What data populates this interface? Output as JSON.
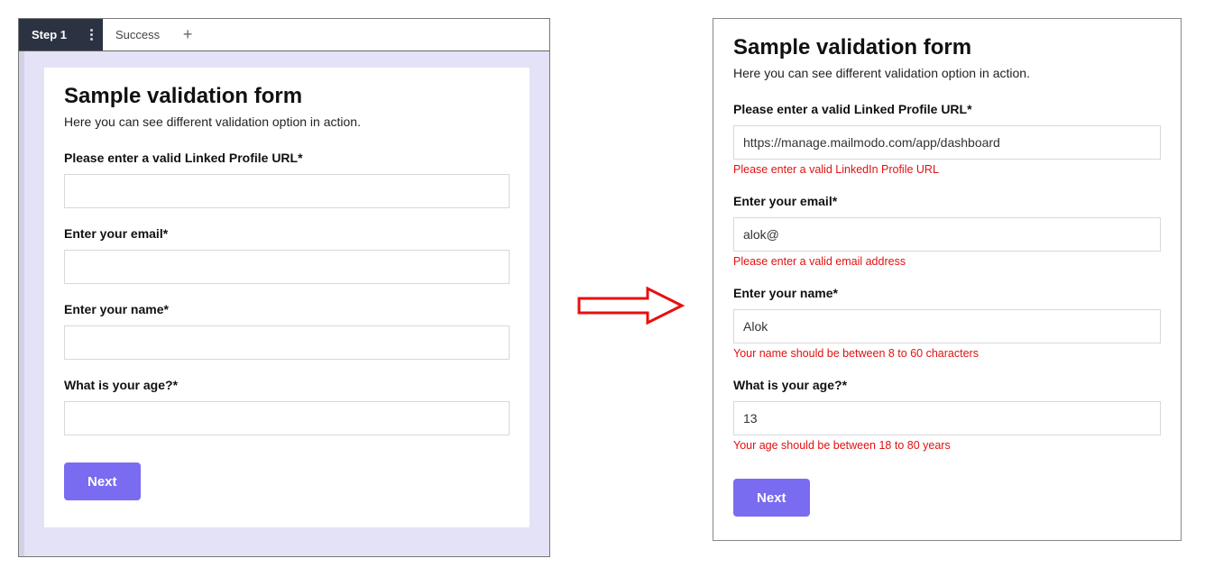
{
  "left": {
    "tabs": {
      "step1": "Step 1",
      "success": "Success",
      "add": "+"
    },
    "form": {
      "title": "Sample validation form",
      "subtitle": "Here you can see different validation option in action.",
      "fields": {
        "linked": {
          "label": "Please enter a valid Linked Profile URL*",
          "value": ""
        },
        "email": {
          "label": "Enter your email*",
          "value": ""
        },
        "name": {
          "label": "Enter your name*",
          "value": ""
        },
        "age": {
          "label": "What is your age?*",
          "value": ""
        }
      },
      "next": "Next"
    }
  },
  "right": {
    "form": {
      "title": "Sample validation form",
      "subtitle": "Here you can see different validation option in action.",
      "fields": {
        "linked": {
          "label": "Please enter a valid Linked Profile URL*",
          "value": "https://manage.mailmodo.com/app/dashboard",
          "error": "Please enter a valid LinkedIn Profile URL"
        },
        "email": {
          "label": "Enter your email*",
          "value": "alok@",
          "error": "Please enter a valid email address"
        },
        "name": {
          "label": "Enter your name*",
          "value": "Alok",
          "error": "Your name should be between 8 to 60 characters"
        },
        "age": {
          "label": "What is your age?*",
          "value": "13",
          "error": "Your age should be between 18 to 80 years"
        }
      },
      "next": "Next"
    }
  },
  "arrow_color": "#e80f0f"
}
